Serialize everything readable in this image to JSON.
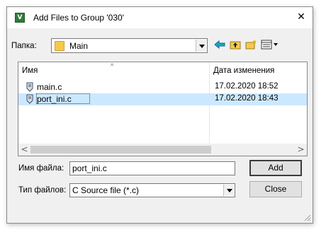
{
  "window": {
    "title": "Add Files to Group '030'",
    "app_icon_text": "V",
    "close_symbol": "✕"
  },
  "location": {
    "label": "Папка:",
    "current_folder": "Main"
  },
  "toolbar": {
    "icons": [
      "back-arrow-icon",
      "up-folder-icon",
      "new-folder-icon",
      "view-menu-icon"
    ]
  },
  "file_list": {
    "columns": [
      "Имя",
      "Дата изменения"
    ],
    "sort_indicator": "^",
    "rows": [
      {
        "name": "main.c",
        "modified": "17.02.2020 18:52",
        "selected": false
      },
      {
        "name": "port_ini.c",
        "modified": "17.02.2020 18:43",
        "selected": true
      }
    ]
  },
  "filename": {
    "label": "Имя файла:",
    "value": "port_ini.c"
  },
  "filetype": {
    "label": "Тип файлов:",
    "value": "C Source file (*.c)"
  },
  "buttons": {
    "add": "Add",
    "close": "Close"
  },
  "scrollbar": {
    "left_arrow": "<",
    "right_arrow": ">"
  },
  "colors": {
    "selection": "#cce8ff",
    "dialog_bg": "#f0f0f0",
    "folder": "#f6c94a"
  }
}
